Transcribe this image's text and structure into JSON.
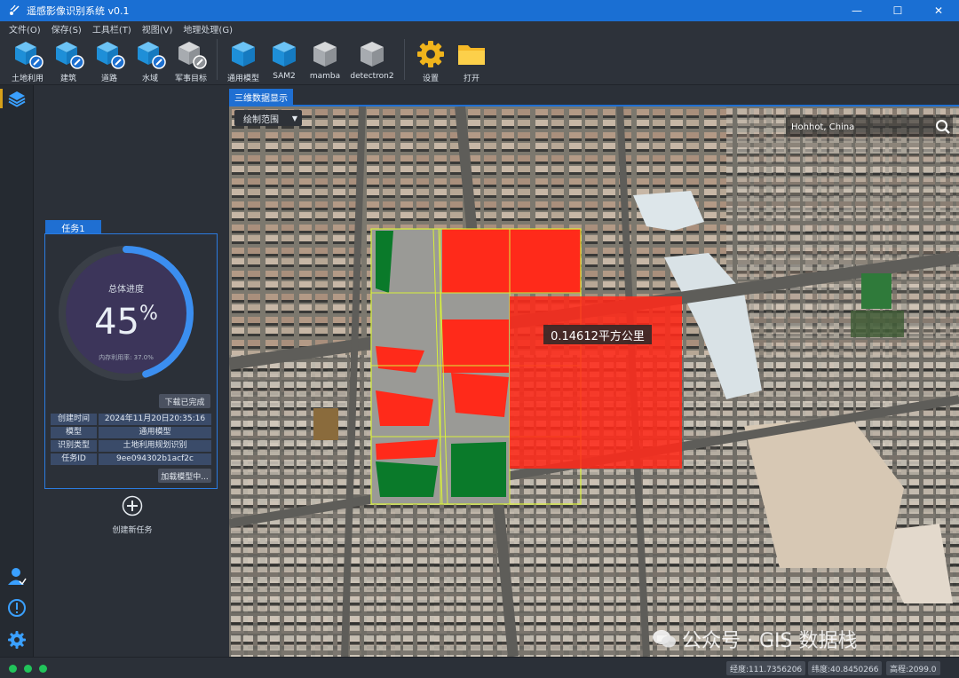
{
  "window": {
    "title": "遥感影像识别系统 v0.1",
    "minimize": "—",
    "maximize": "☐",
    "close": "✕"
  },
  "menu": [
    "文件(O)",
    "保存(S)",
    "工具栏(T)",
    "视图(V)",
    "地理处理(G)"
  ],
  "toolbar": {
    "tools": [
      {
        "label": "土地利用",
        "icon": "cube-edit-icon",
        "color": "#2aa0e8"
      },
      {
        "label": "建筑",
        "icon": "cube-edit-icon",
        "color": "#2aa0e8"
      },
      {
        "label": "道路",
        "icon": "cube-edit-icon",
        "color": "#2aa0e8"
      },
      {
        "label": "水域",
        "icon": "cube-edit-icon",
        "color": "#2aa0e8"
      },
      {
        "label": "军事目标",
        "icon": "cube-edit-icon",
        "color": "#9aa0a6"
      }
    ],
    "models": [
      {
        "label": "通用模型",
        "color": "#2aa0e8"
      },
      {
        "label": "SAM2",
        "color": "#2aa0e8"
      },
      {
        "label": "mamba",
        "color": "#9aa0a6"
      },
      {
        "label": "detectron2",
        "color": "#9aa0a6"
      }
    ],
    "settings_label": "设置",
    "open_label": "打开"
  },
  "task": {
    "tab_label": "任务1",
    "progress_title": "总体进度",
    "progress_value": "45",
    "progress_unit": "%",
    "progress_fraction": 0.45,
    "memory_label": "内存利用率: 37.0%",
    "download_label": "下载已完成",
    "info": [
      {
        "key": "创建时间",
        "value": "2024年11月20日20:35:16"
      },
      {
        "key": "模型",
        "value": "通用模型"
      },
      {
        "key": "识别类型",
        "value": "土地利用规划识别"
      },
      {
        "key": "任务ID",
        "value": "9ee094302b1acf2c"
      }
    ],
    "load_label": "加载模型中...",
    "new_task_label": "创建新任务"
  },
  "map": {
    "tab_label": "三维数据显示",
    "draw_select": "绘制范围",
    "search_value": "Hohhot, China",
    "area_label": "0.14612平方公里",
    "watermark": "公众号 · GIS 数据栈"
  },
  "status": {
    "lon": "经度:111.7356206",
    "lat": "纬度:40.8450266",
    "alt": "高程:2099.0"
  },
  "colors": {
    "accent": "#1f6fd2",
    "ring": "#3b8ef0",
    "segment_red": "#ff2a1a",
    "segment_green": "#0a7a2a",
    "grid_yellow": "#d8f03a"
  }
}
